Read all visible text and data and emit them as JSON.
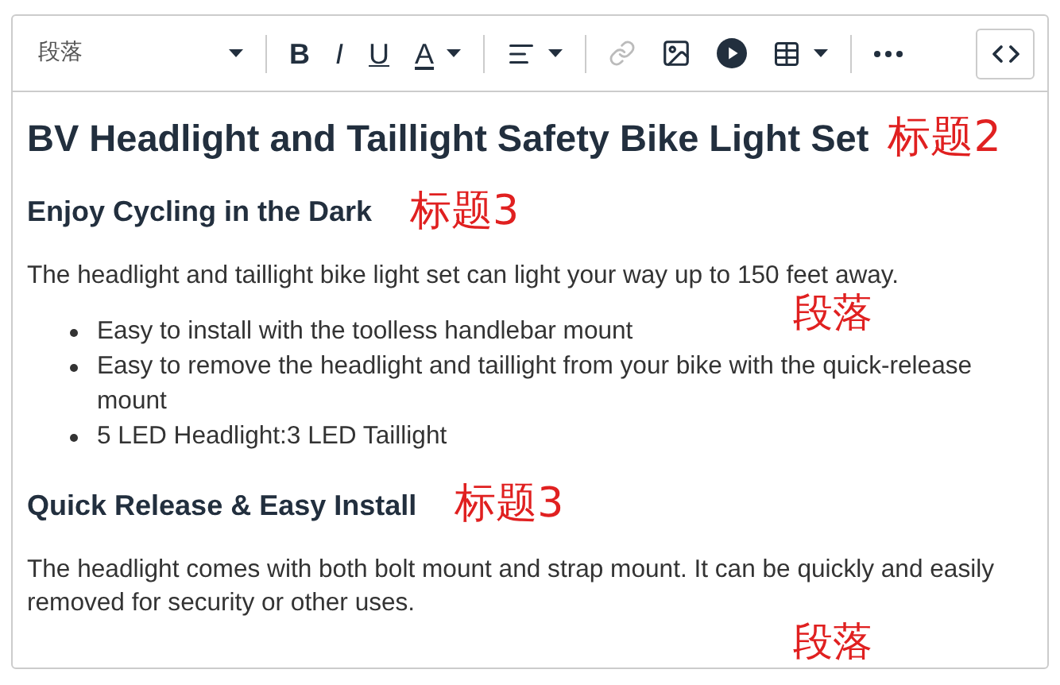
{
  "toolbar": {
    "format": "段落",
    "items": [
      {
        "kind": "bold",
        "label": "B",
        "caret": false,
        "disabled": false
      },
      {
        "kind": "italic",
        "label": "I",
        "caret": false,
        "disabled": false
      },
      {
        "kind": "underline",
        "label": "U",
        "caret": false,
        "disabled": false
      },
      {
        "kind": "color",
        "label": "A",
        "caret": true,
        "disabled": false
      },
      {
        "kind": "sep"
      },
      {
        "kind": "align",
        "caret": true,
        "disabled": false
      },
      {
        "kind": "sep"
      },
      {
        "kind": "link",
        "caret": false,
        "disabled": true
      },
      {
        "kind": "image",
        "caret": false,
        "disabled": false
      },
      {
        "kind": "media",
        "caret": false,
        "disabled": false
      },
      {
        "kind": "table",
        "caret": true,
        "disabled": false
      },
      {
        "kind": "sep"
      },
      {
        "kind": "more",
        "caret": false,
        "disabled": false
      }
    ]
  },
  "content": [
    {
      "kind": "h2",
      "text": "BV Headlight and Taillight Safety Bike Light Set",
      "annotation": "标题2"
    },
    {
      "kind": "h3",
      "text": "Enjoy Cycling in the Dark",
      "annotation": "标题3"
    },
    {
      "kind": "p",
      "text": "The headlight and taillight bike light set can light your way up to 150 feet away.",
      "annotation": "段落"
    },
    {
      "kind": "ul",
      "items": [
        "Easy to install with the toolless handlebar mount",
        "Easy to remove the headlight and taillight from your bike with the quick-release mount",
        "5 LED Headlight:3 LED Taillight"
      ]
    },
    {
      "kind": "h3",
      "text": "Quick Release & Easy Install",
      "annotation": "标题3"
    },
    {
      "kind": "p",
      "text": "The headlight comes with both bolt mount and strap mount. It can be quickly and easily removed for security or other uses.",
      "annotation": "段落"
    }
  ]
}
